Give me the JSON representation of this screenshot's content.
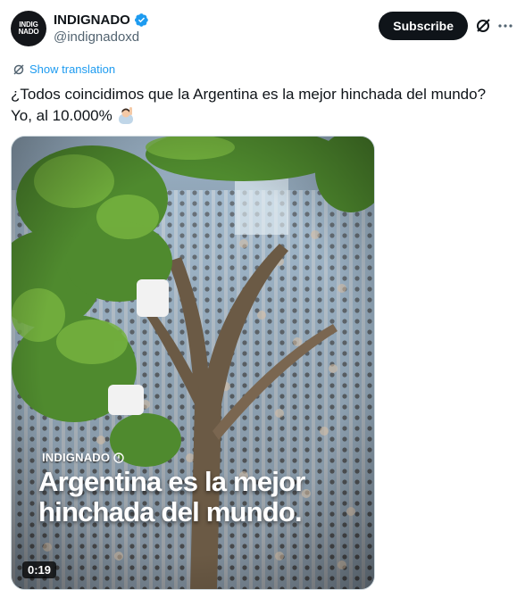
{
  "author": {
    "avatar_text_line1": "INDIG",
    "avatar_text_line2": "NADO",
    "display_name": "INDIGNADO",
    "handle": "@indignadoxd",
    "verified": true
  },
  "header": {
    "subscribe_label": "Subscribe"
  },
  "translation": {
    "label": "Show translation"
  },
  "post": {
    "line1": "¿Todos coincidimos que la Argentina es la mejor hinchada del mundo?",
    "line2": "Yo, al 10.000%",
    "emoji": "raising-hand-emoji"
  },
  "media": {
    "watermark": "INDIGNADO",
    "caption_line1": "Argentina es la mejor",
    "caption_line2": "hinchada del mundo.",
    "duration": "0:19"
  },
  "colors": {
    "accent": "#1d9bf0",
    "text": "#0f1419",
    "secondary_text": "#536471",
    "button_bg": "#0f1419"
  }
}
